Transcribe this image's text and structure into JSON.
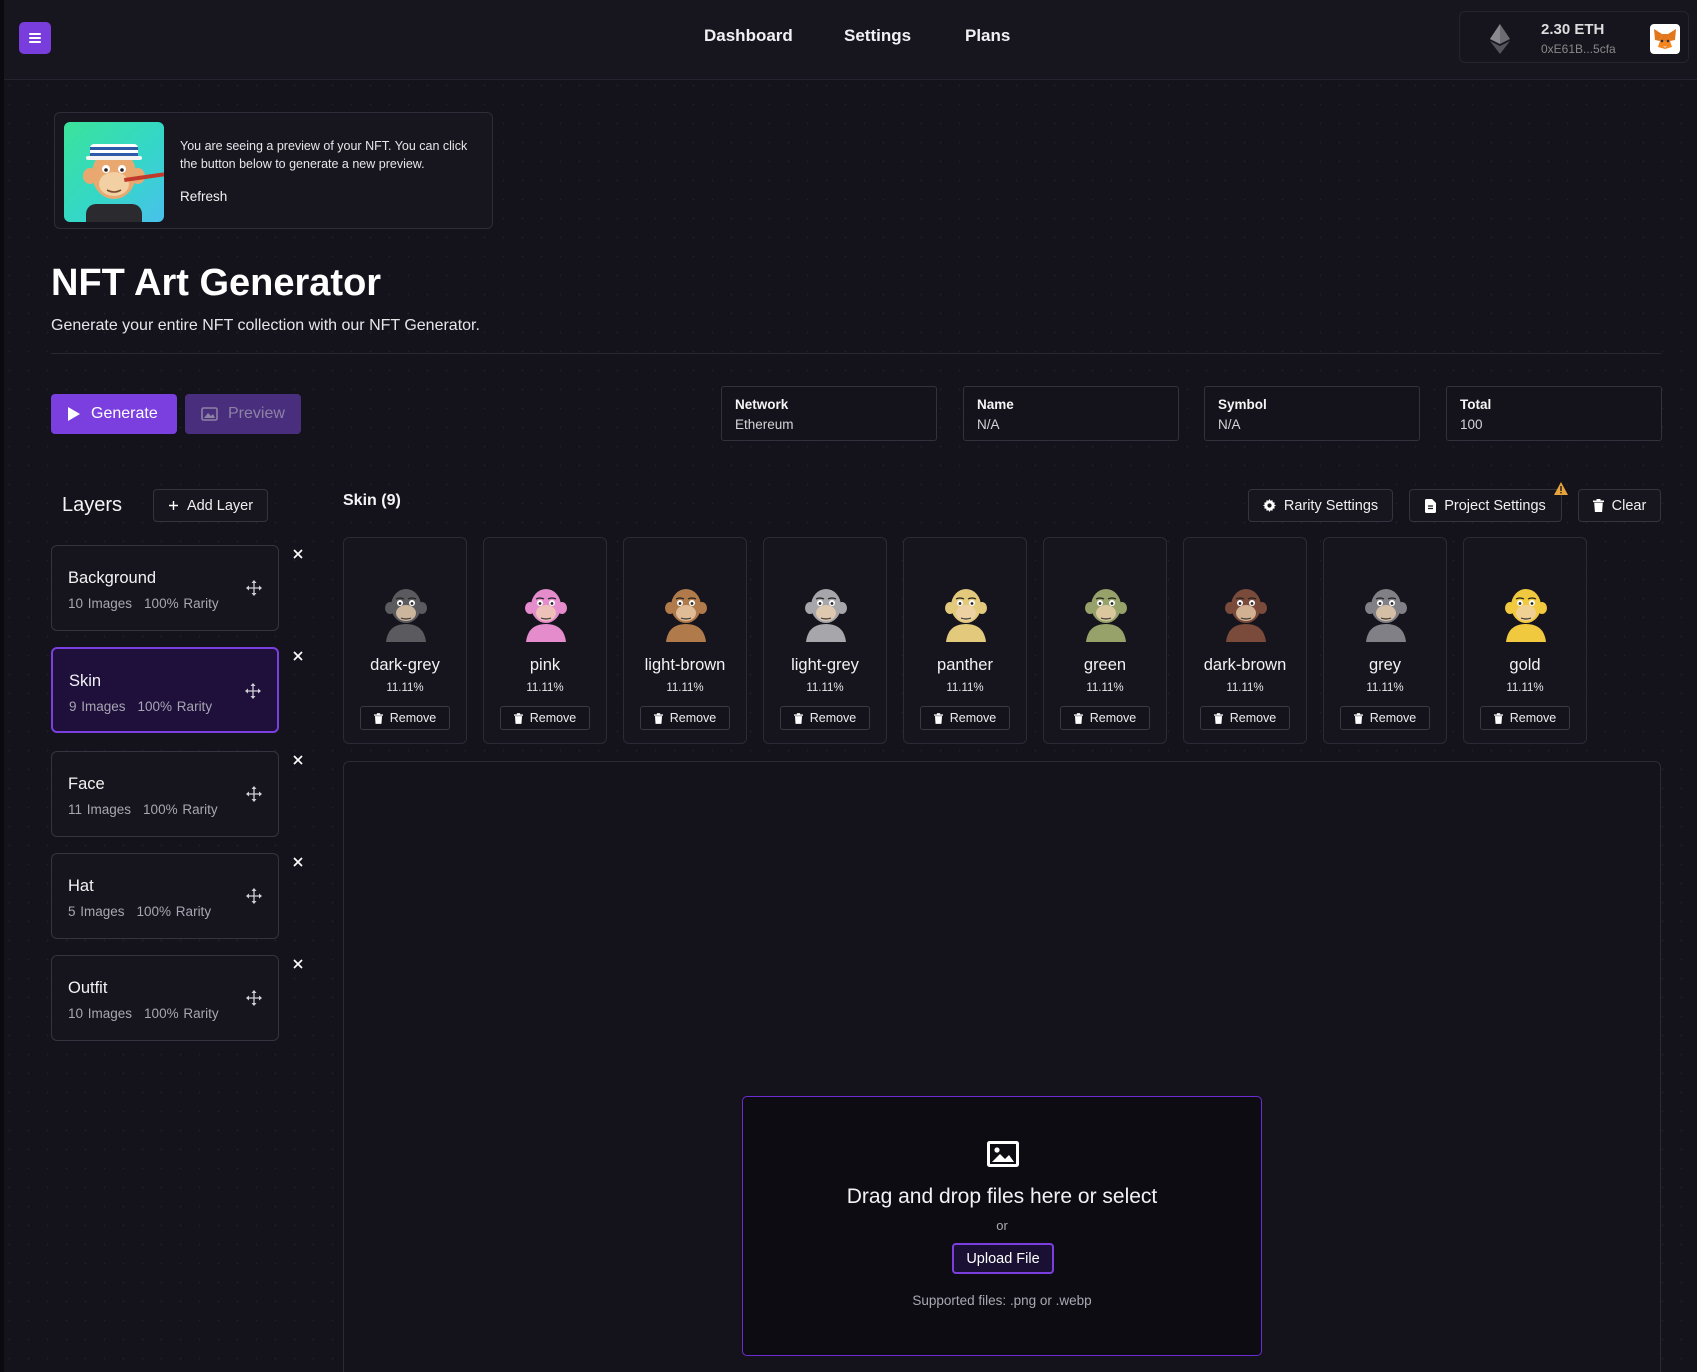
{
  "header": {
    "nav": [
      "Dashboard",
      "Settings",
      "Plans"
    ],
    "wallet": {
      "balance": "2.30 ETH",
      "address": "0xE61B...5cfa"
    },
    "accent": "#7b3fe0"
  },
  "preview": {
    "text": "You are seeing a preview of your NFT. You can click the button below to generate a new preview.",
    "refresh_label": "Refresh"
  },
  "page": {
    "title": "NFT Art Generator",
    "subtitle": "Generate your entire NFT collection with our NFT Generator."
  },
  "actions": {
    "generate": "Generate",
    "preview": "Preview"
  },
  "info": [
    {
      "label": "Network",
      "value": "Ethereum"
    },
    {
      "label": "Name",
      "value": "N/A"
    },
    {
      "label": "Symbol",
      "value": "N/A"
    },
    {
      "label": "Total",
      "value": "100"
    }
  ],
  "layers": {
    "title": "Layers",
    "add_label": "Add Layer",
    "items": [
      {
        "name": "Background",
        "images": "10 Images",
        "rarity": "100% Rarity",
        "active": false
      },
      {
        "name": "Skin",
        "images": "9 Images",
        "rarity": "100% Rarity",
        "active": true
      },
      {
        "name": "Face",
        "images": "11 Images",
        "rarity": "100% Rarity",
        "active": false
      },
      {
        "name": "Hat",
        "images": "5 Images",
        "rarity": "100% Rarity",
        "active": false
      },
      {
        "name": "Outfit",
        "images": "10 Images",
        "rarity": "100% Rarity",
        "active": false
      }
    ]
  },
  "skin": {
    "title": "Skin (9)",
    "tools": {
      "rarity": "Rarity Settings",
      "project": "Project Settings",
      "clear": "Clear"
    },
    "remove_label": "Remove",
    "traits": [
      {
        "name": "dark-grey",
        "pct": "11.11%",
        "color": "#5b5b5f"
      },
      {
        "name": "pink",
        "pct": "11.11%",
        "color": "#e58ccd"
      },
      {
        "name": "light-brown",
        "pct": "11.11%",
        "color": "#b07a4a"
      },
      {
        "name": "light-grey",
        "pct": "11.11%",
        "color": "#a7a7ab"
      },
      {
        "name": "panther",
        "pct": "11.11%",
        "color": "#e2c97c"
      },
      {
        "name": "green",
        "pct": "11.11%",
        "color": "#96a26a"
      },
      {
        "name": "dark-brown",
        "pct": "11.11%",
        "color": "#7a4b3a"
      },
      {
        "name": "grey",
        "pct": "11.11%",
        "color": "#808086"
      },
      {
        "name": "gold",
        "pct": "11.11%",
        "color": "#f1c93e"
      }
    ]
  },
  "dropzone": {
    "title": "Drag and drop files here or select",
    "or": "or",
    "upload_label": "Upload File",
    "supported": "Supported files: .png or .webp"
  }
}
